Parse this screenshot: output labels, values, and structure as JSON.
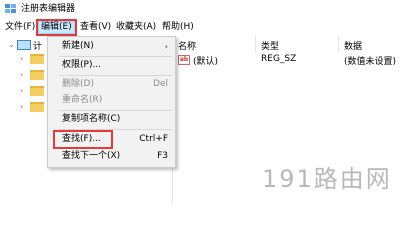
{
  "window": {
    "title": "注册表编辑器"
  },
  "menubar": {
    "items": [
      {
        "label": "文件(F)"
      },
      {
        "label": "编辑(E)"
      },
      {
        "label": "查看(V)"
      },
      {
        "label": "收藏夹(A)"
      },
      {
        "label": "帮助(H)"
      }
    ]
  },
  "tree": {
    "root_label_cut": "计"
  },
  "edit_menu": {
    "items": [
      {
        "label": "新建(N)",
        "submenu": true,
        "enabled": true
      },
      {
        "label": "权限(P)...",
        "enabled": true
      },
      {
        "label": "删除(D)",
        "shortcut": "Del",
        "enabled": false
      },
      {
        "label": "重命名(R)",
        "enabled": false
      },
      {
        "label": "复制项名称(C)",
        "enabled": true
      },
      {
        "label": "查找(F)...",
        "shortcut": "Ctrl+F",
        "enabled": true,
        "highlighted": true
      },
      {
        "label": "查找下一个(X)",
        "shortcut": "F3",
        "enabled": true
      }
    ]
  },
  "list": {
    "columns": [
      "名称",
      "类型",
      "数据"
    ],
    "rows": [
      {
        "icon": "ab",
        "name": "(默认)",
        "type": "REG_SZ",
        "data": "(数值未设置)"
      }
    ]
  },
  "watermark": "191路由网",
  "colors": {
    "highlight_box": "#e23b3b",
    "menu_active": "#cce8ff",
    "folder": "#f2cd62"
  }
}
